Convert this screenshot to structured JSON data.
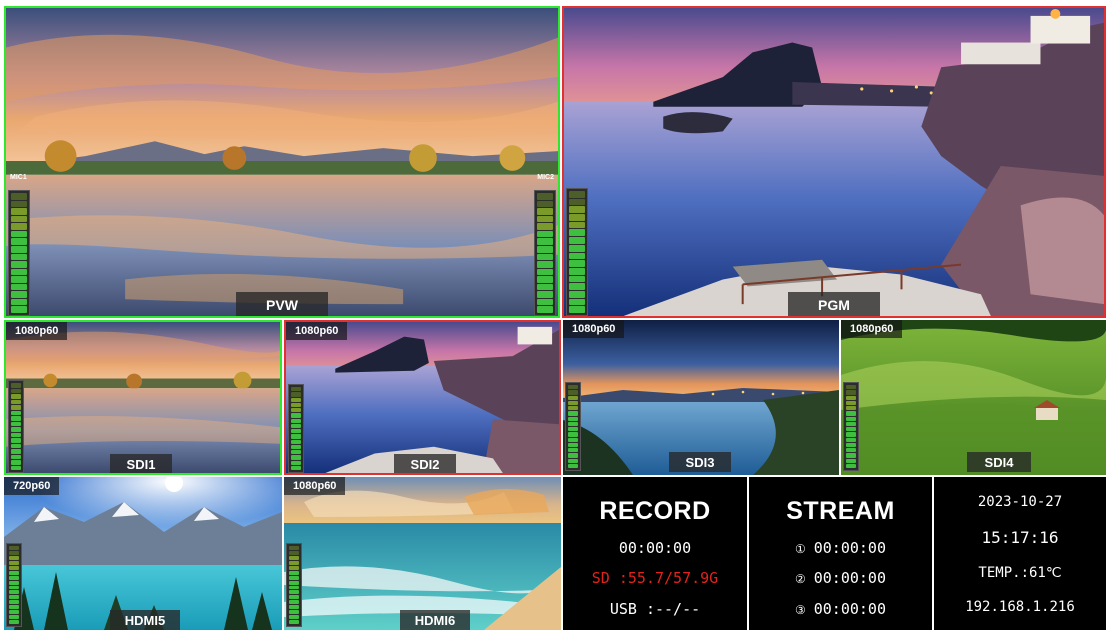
{
  "colors": {
    "pvw_border": "#2ee82e",
    "pgm_border": "#e03030",
    "record_sd": "#e3231b"
  },
  "pvw": {
    "label": "PVW",
    "mic_left": "MIC1",
    "mic_right": "MIC2"
  },
  "pgm": {
    "label": "PGM"
  },
  "inputs": [
    {
      "resolution": "1080p60",
      "label": "SDI1",
      "image": "sunset lake reflection"
    },
    {
      "resolution": "1080p60",
      "label": "SDI2",
      "image": "coastal cliff village at dusk"
    },
    {
      "resolution": "1080p60",
      "label": "SDI3",
      "image": "coastal city bay at twilight"
    },
    {
      "resolution": "1080p60",
      "label": "SDI4",
      "image": "green rolling hills farmhouse"
    },
    {
      "resolution": "720p60",
      "label": "HDMI5",
      "image": "mountain lake with pine trees"
    },
    {
      "resolution": "1080p60",
      "label": "HDMI6",
      "image": "tropical beach waves"
    }
  ],
  "record": {
    "title": "RECORD",
    "time": "00:00:00",
    "sd": "SD :55.7/57.9G",
    "usb": "USB :--/--"
  },
  "stream": {
    "title": "STREAM",
    "items": [
      {
        "icon": "①",
        "time": "00:00:00"
      },
      {
        "icon": "②",
        "time": "00:00:00"
      },
      {
        "icon": "③",
        "time": "00:00:00"
      }
    ]
  },
  "status": {
    "date": "2023-10-27",
    "time": "15:17:16",
    "temp": "TEMP.:61℃",
    "ip": "192.168.1.216"
  }
}
